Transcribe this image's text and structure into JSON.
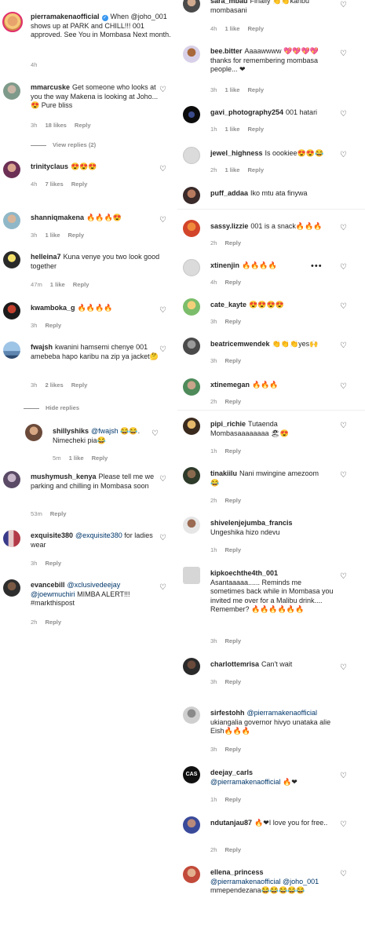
{
  "left_comments": [
    {
      "username": "pierramakenaofficial",
      "verified": true,
      "mention": "@joho_001",
      "text": "When @joho_001 shows up at PARK and CHILL!!! 001 approved. See You in Mombasa Next month.",
      "time": "4h"
    },
    {
      "username": "mmarcuske",
      "text": "Get someone who looks at you the way Makena is looking at Joho... 😍 Pure bliss",
      "time": "3h",
      "likes": "18 likes",
      "reply": "Reply"
    },
    {
      "username": "trinityclaus",
      "text": "😍😍😍",
      "time": "4h",
      "likes": "7 likes",
      "reply": "Reply"
    },
    {
      "username": "shanniqmakena",
      "text": "🔥🔥🔥😍",
      "time": "3h",
      "likes": "1 like",
      "reply": "Reply"
    },
    {
      "username": "helleina7",
      "text": "Kuna venye you two look good together",
      "time": "47m",
      "likes": "1 like",
      "reply": "Reply"
    },
    {
      "username": "kwamboka_g",
      "text": "🔥🔥🔥🔥",
      "time": "3h",
      "reply": "Reply"
    },
    {
      "username": "fwajsh",
      "text": "kwanini hamsemi chenye 001 amebeba hapo karibu na zip ya jacket🤔",
      "time": "3h",
      "likes": "2 likes",
      "reply": "Reply"
    },
    {
      "username": "shillyshiks",
      "mention": "@fwajsh",
      "text": "😂😂. Nimecheki pia😂",
      "time": "5m",
      "likes": "1 like",
      "reply": "Reply"
    },
    {
      "username": "mushymush_kenya",
      "text": "Please tell me we parking and chilling in Mombasa soon",
      "time": "53m",
      "reply": "Reply"
    },
    {
      "username": "exquisite380",
      "mention": "@exquisite380",
      "text": "for ladies wear",
      "time": "3h",
      "reply": "Reply"
    },
    {
      "username": "evancebill",
      "mention": "@xclusivedeejay @joewmuchiri",
      "text": "MIMBA ALERT!!! #markthispost",
      "time": "2h",
      "reply": "Reply"
    }
  ],
  "view_replies": "View replies (2)",
  "hide_replies": "Hide replies",
  "right_comments": [
    {
      "username": "sara_mbau",
      "text": "Finally 👏👏karibu mombasani",
      "time": "4h",
      "likes": "1 like",
      "reply": "Reply"
    },
    {
      "username": "bee.bitter",
      "text": "Aaaawwww 💖💖💖💖 thanks for remembering mombasa people... ❤",
      "time": "3h",
      "likes": "1 like",
      "reply": "Reply"
    },
    {
      "username": "gavi_photography254",
      "text": "001 hatari",
      "time": "1h",
      "likes": "1 like",
      "reply": "Reply"
    },
    {
      "username": "jewel_highness",
      "text": "Is oookiee😍😍😂",
      "time": "2h",
      "likes": "1 like",
      "reply": "Reply"
    },
    {
      "username": "puff_addaa",
      "text": "Iko mtu ata finywa"
    },
    {
      "username": "sassy.lizzie",
      "text": "001 is a snack🔥🔥🔥",
      "time": "2h",
      "reply": "Reply"
    },
    {
      "username": "xtinenjin",
      "text": "🔥🔥🔥🔥",
      "time": "4h",
      "reply": "Reply"
    },
    {
      "username": "cate_kayte",
      "text": "😍😍😍😍",
      "time": "3h",
      "reply": "Reply"
    },
    {
      "username": "beatricemwendek",
      "text": "👏👏👏yes🙌",
      "time": "3h",
      "reply": "Reply"
    },
    {
      "username": "xtinemegan",
      "text": "🔥🔥🔥",
      "time": "2h",
      "reply": "Reply"
    },
    {
      "username": "pipi_richie",
      "text": "Tutaenda Mombasaaaaaaaa 🏖😍",
      "time": "1h",
      "reply": "Reply"
    },
    {
      "username": "tinakiilu",
      "text": "Nani mwingine amezoom😂",
      "time": "2h",
      "reply": "Reply"
    },
    {
      "username": "shivelenjejumba_francis",
      "text": "Ungeshika hizo ndevu",
      "time": "1h",
      "reply": "Reply"
    },
    {
      "username": "kipkoechthe4th_001",
      "text": "Asantaaaaa...... Reminds me sometimes back while in Mombasa you invited me over for a Malibu drink.... Remember? 🔥🔥🔥🔥🔥🔥",
      "time": "3h",
      "reply": "Reply"
    },
    {
      "username": "charlottemrisa",
      "text": "Can't wait",
      "time": "3h",
      "reply": "Reply"
    },
    {
      "username": "sirfestohh",
      "mention": "@pierramakenaofficial",
      "text": "ukiangalia governor hivyo unataka alie Eish🔥🔥🔥",
      "time": "3h",
      "reply": "Reply"
    },
    {
      "username": "deejay_carls",
      "mention": "@pierramakenaofficial",
      "text": "🔥❤",
      "time": "1h",
      "reply": "Reply"
    },
    {
      "username": "ndutanjau87",
      "text": "🔥❤I love you for free..",
      "time": "2h",
      "reply": "Reply"
    },
    {
      "username": "ellena_princess",
      "mention": "@pierramakenaofficial @joho_001",
      "text": "mmependezana😂😂😂😂😂",
      "time": "",
      "reply": ""
    }
  ],
  "colors": {
    "text": "#262626",
    "meta": "#8e8e8e",
    "mention": "#00376b",
    "verified": "#3897f0",
    "border": "#efefef"
  },
  "icons": {
    "heart": "heart-icon",
    "more": "more-options-icon",
    "verified": "verified-badge-icon"
  }
}
